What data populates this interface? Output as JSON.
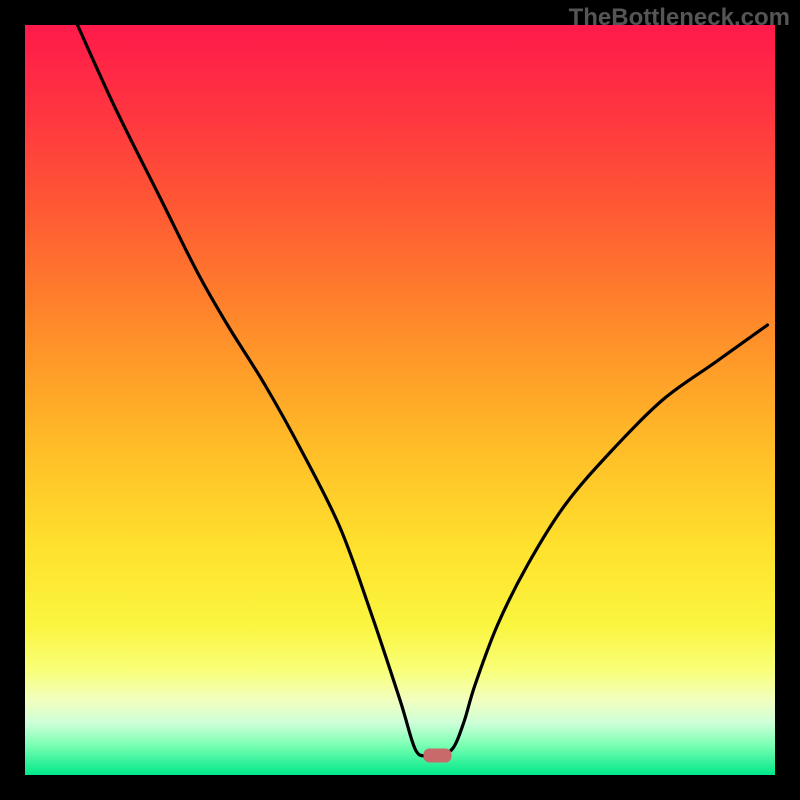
{
  "watermark": "TheBottleneck.com",
  "chart_data": {
    "type": "line",
    "title": "",
    "xlabel": "",
    "ylabel": "",
    "xlim": [
      0,
      100
    ],
    "ylim": [
      0,
      100
    ],
    "gradient_stops": [
      {
        "offset": 0,
        "color": "#ff1a4b"
      },
      {
        "offset": 12,
        "color": "#ff3640"
      },
      {
        "offset": 25,
        "color": "#ff5a33"
      },
      {
        "offset": 40,
        "color": "#ff8a2a"
      },
      {
        "offset": 55,
        "color": "#ffb927"
      },
      {
        "offset": 70,
        "color": "#ffe22d"
      },
      {
        "offset": 80,
        "color": "#faf53f"
      },
      {
        "offset": 86,
        "color": "#f9ff78"
      },
      {
        "offset": 90,
        "color": "#f2ffbf"
      },
      {
        "offset": 93,
        "color": "#cfffd8"
      },
      {
        "offset": 96,
        "color": "#7bffb4"
      },
      {
        "offset": 100,
        "color": "#00e888"
      }
    ],
    "series": [
      {
        "name": "bottleneck-curve",
        "x": [
          7,
          12,
          18,
          23,
          27,
          32,
          37,
          42,
          46,
          50,
          52,
          53.5,
          55,
          57,
          58.5,
          60,
          63,
          67,
          72,
          78,
          85,
          92,
          99
        ],
        "y": [
          100,
          89,
          77,
          67,
          60,
          52,
          43,
          33,
          22,
          10,
          3.5,
          2.5,
          2.5,
          3.5,
          7,
          12,
          20,
          28,
          36,
          43,
          50,
          55,
          60
        ]
      }
    ],
    "marker": {
      "x": 55,
      "y": 2.6,
      "color": "#c86a6a"
    }
  }
}
